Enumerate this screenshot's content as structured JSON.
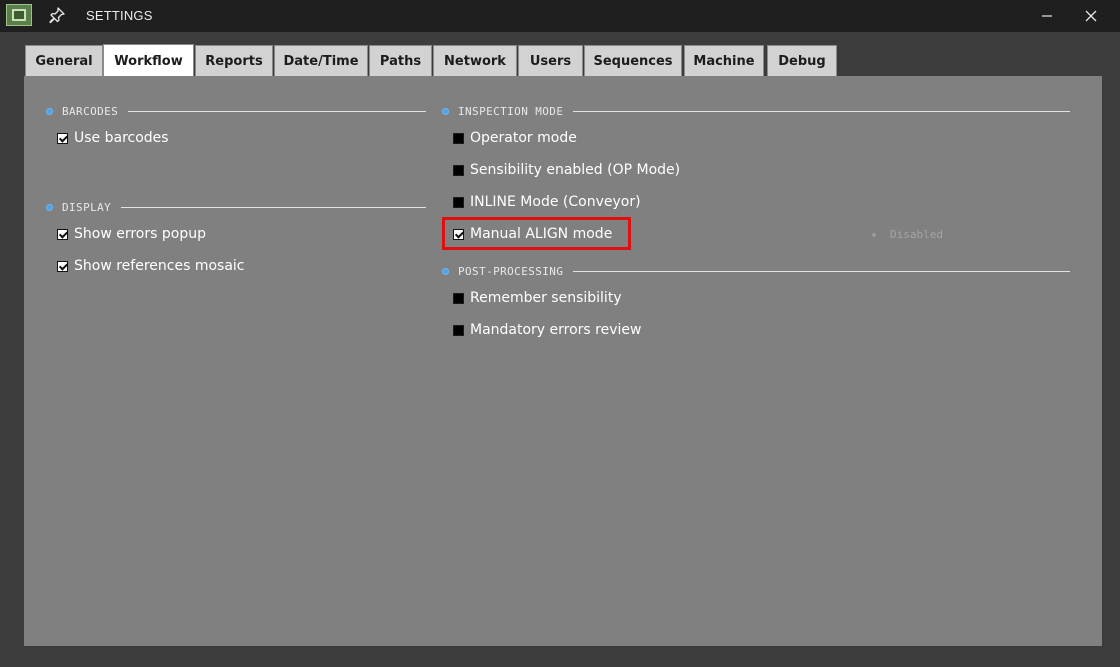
{
  "window": {
    "title": "SETTINGS"
  },
  "tabs": [
    {
      "label": "General",
      "active": false
    },
    {
      "label": "Workflow",
      "active": true
    },
    {
      "label": "Reports",
      "active": false
    },
    {
      "label": "Date/Time",
      "active": false
    },
    {
      "label": "Paths",
      "active": false
    },
    {
      "label": "Network",
      "active": false
    },
    {
      "label": "Users",
      "active": false
    },
    {
      "label": "Sequences",
      "active": false
    },
    {
      "label": "Machine",
      "active": false
    },
    {
      "label": "Debug",
      "active": false
    }
  ],
  "barcodes": {
    "title": "BARCODES",
    "use_barcodes": {
      "label": "Use barcodes",
      "checked": true
    }
  },
  "display": {
    "title": "DISPLAY",
    "show_errors_popup": {
      "label": "Show errors popup",
      "checked": true
    },
    "show_references_mosaic": {
      "label": "Show references mosaic",
      "checked": true
    }
  },
  "inspection_mode": {
    "title": "INSPECTION MODE",
    "operator_mode": {
      "label": "Operator mode",
      "checked": false
    },
    "sensibility_enabled": {
      "label": "Sensibility enabled (OP Mode)",
      "checked": false
    },
    "inline_mode": {
      "label": "INLINE Mode (Conveyor)",
      "checked": false
    },
    "inline_status": "Disabled",
    "manual_align": {
      "label": "Manual ALIGN mode",
      "checked": true
    }
  },
  "post_processing": {
    "title": "POST-PROCESSING",
    "remember_sensibility": {
      "label": "Remember sensibility",
      "checked": false
    },
    "mandatory_errors_review": {
      "label": "Mandatory errors review",
      "checked": false
    }
  },
  "colors": {
    "panel_bg": "#808080",
    "highlight": "#e01010",
    "section_bullet": "#4da3e6"
  }
}
